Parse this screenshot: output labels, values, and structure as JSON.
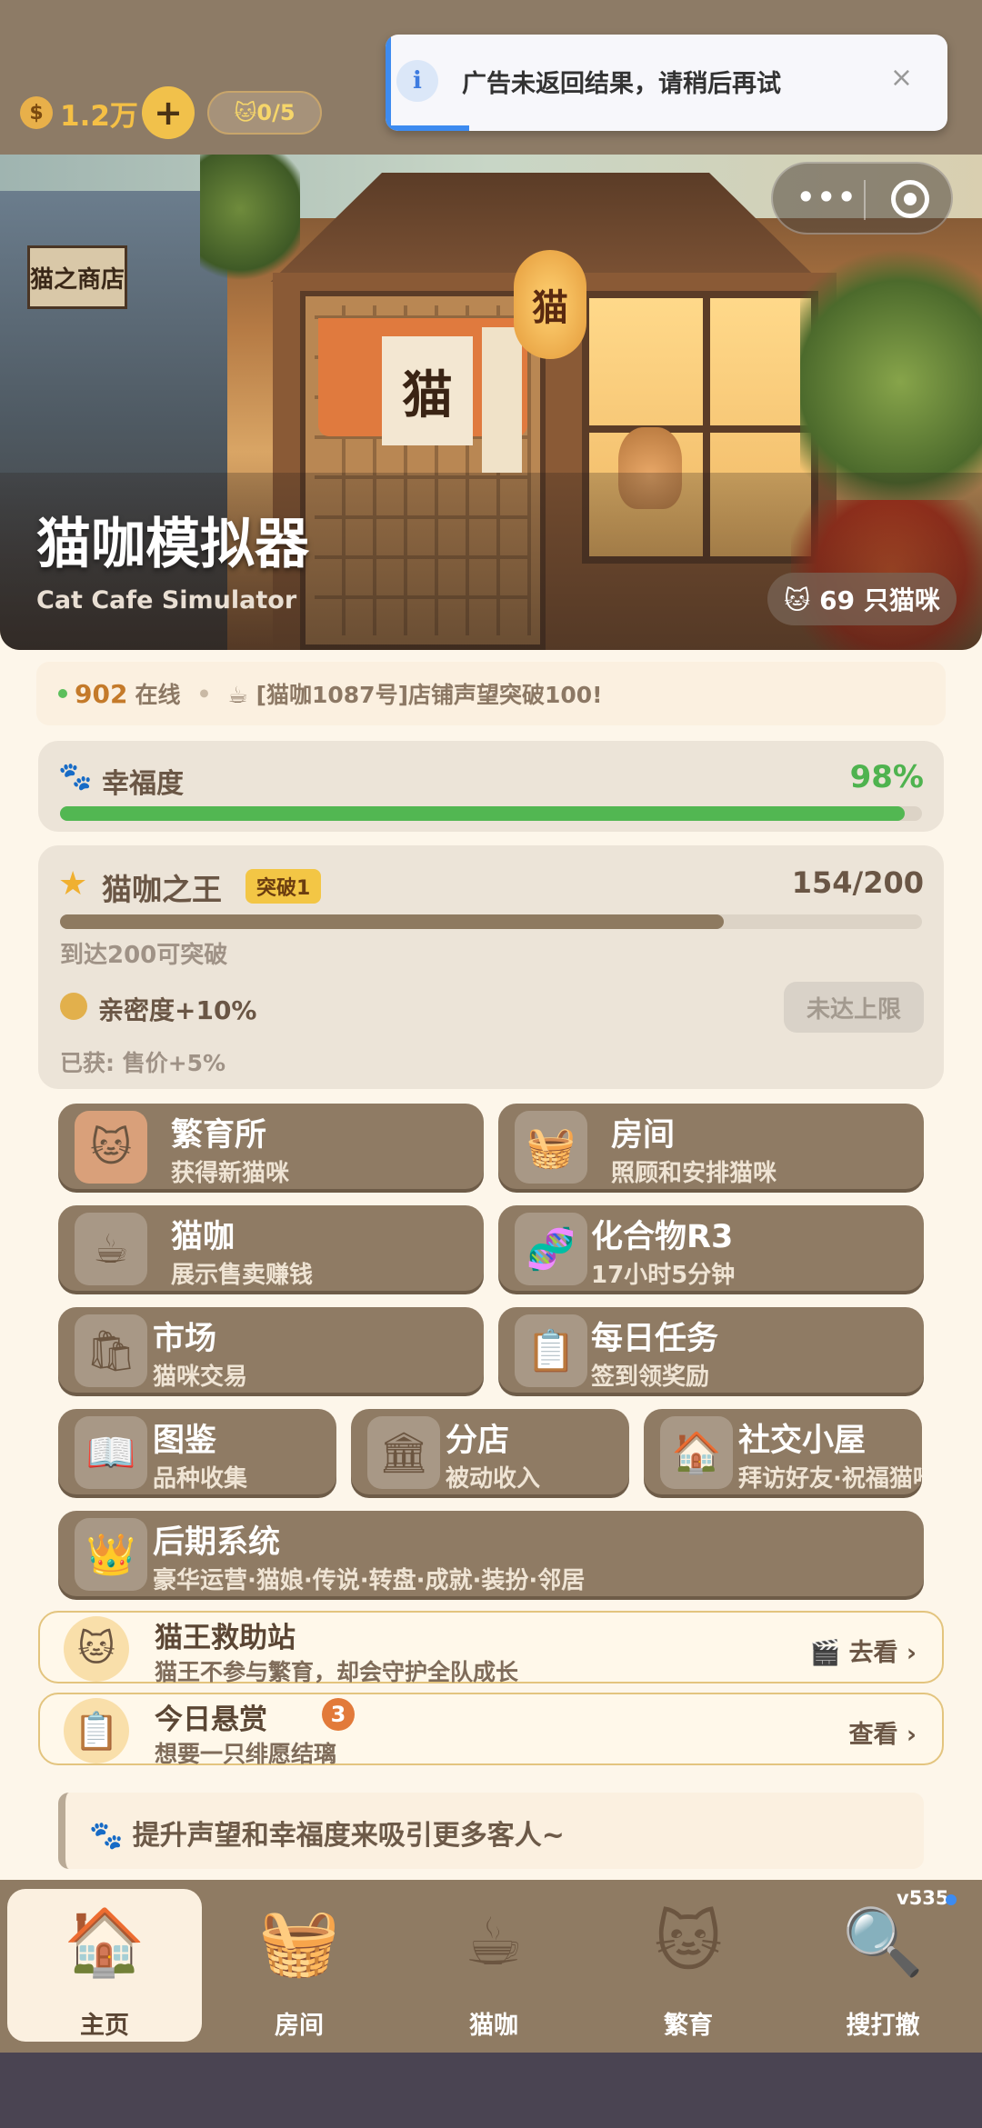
{
  "top": {
    "coins": "1.2万",
    "coin_icon": "money-bag-icon",
    "add_label": "+",
    "cat_count": "🐱0/5"
  },
  "toast": {
    "message": "广告未返回结果，请稍后再试",
    "icon": "i",
    "close": "×"
  },
  "hero": {
    "title": "猫咖模拟器",
    "subtitle": "Cat Cafe Simulator",
    "cat_badge": "🐱 69 只猫咪",
    "shop_sign": "猫之商店",
    "noren_char": "猫",
    "lantern_char": "猫"
  },
  "ticker": {
    "online_count": "902",
    "online_label": "在线",
    "separator": "•",
    "news": "☕ [猫咖1087号]店铺声望突破100!"
  },
  "happiness": {
    "label": "幸福度",
    "value": "98%",
    "fraction": 0.98
  },
  "king": {
    "title": "猫咖之王",
    "badge": "突破1",
    "progress": "154/200",
    "fraction": 0.77,
    "hint": "到达200可突破",
    "bonus": "亲密度+10%",
    "button": "未达上限",
    "earned": "已获: 售价+5%"
  },
  "tiles": [
    {
      "title": "繁育所",
      "sub": "获得新猫咪",
      "icon": "🐱"
    },
    {
      "title": "房间",
      "sub": "照顾和安排猫咪",
      "icon": "🧺"
    },
    {
      "title": "猫咖",
      "sub": "展示售卖赚钱",
      "icon": "☕"
    },
    {
      "title": "化合物R3",
      "sub": "17小时5分钟",
      "icon": "🧬"
    },
    {
      "title": "市场",
      "sub": "猫咪交易",
      "icon": "🛍"
    },
    {
      "title": "每日任务",
      "sub": "签到领奖励",
      "icon": "📋"
    },
    {
      "title": "图鉴",
      "sub": "品种收集",
      "icon": "📖"
    },
    {
      "title": "分店",
      "sub": "被动收入",
      "icon": "🏛"
    },
    {
      "title": "社交小屋",
      "sub": "拜访好友·祝福猫咪",
      "icon": "🏠"
    },
    {
      "title": "后期系统",
      "sub": "豪华运营·猫娘·传说·转盘·成就·装扮·邻居",
      "icon": "👑"
    }
  ],
  "rescue": {
    "title": "猫王救助站",
    "sub": "猫王不参与繁育，却会守护全队成长",
    "action": "🎬 去看 ›"
  },
  "bounty": {
    "title": "今日悬赏",
    "count": "3",
    "sub": "想要一只绯愿结璃",
    "action": "查看 ›"
  },
  "tip": "🐾 提升声望和幸福度来吸引更多客人~",
  "version": "v535",
  "tabs": [
    {
      "label": "主页",
      "icon": "🏠"
    },
    {
      "label": "房间",
      "icon": "🧺"
    },
    {
      "label": "猫咖",
      "icon": "☕"
    },
    {
      "label": "繁育",
      "icon": "🐱"
    },
    {
      "label": "搜打撤",
      "icon": "🔍"
    }
  ],
  "colors": {
    "brand_brown": "#8f7b64",
    "happy_green": "#52b752",
    "toast_blue": "#3d8bf0",
    "gold": "#f3c645"
  }
}
